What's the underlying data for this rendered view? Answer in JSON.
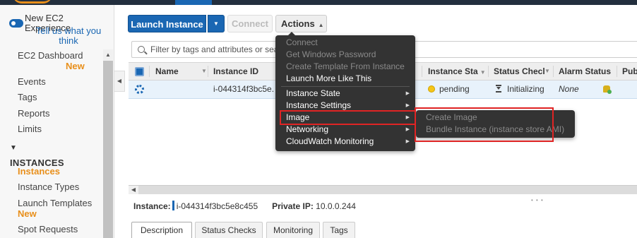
{
  "sidebar": {
    "new_experience_label": "New EC2 Experience",
    "tell_us_link": "Tell us what you think",
    "items": [
      {
        "label": "EC2 Dashboard",
        "badge": "New"
      },
      {
        "label": "Events"
      },
      {
        "label": "Tags"
      },
      {
        "label": "Reports"
      },
      {
        "label": "Limits"
      },
      {
        "label": "Instances"
      },
      {
        "label": "Instance Types"
      },
      {
        "label": "Launch Templates",
        "badge": "New"
      },
      {
        "label": "Spot Requests"
      }
    ],
    "section_instances": "INSTANCES",
    "section_arrow": "▼"
  },
  "toolbar": {
    "launch_label": "Launch Instance",
    "connect_label": "Connect",
    "actions_label": "Actions"
  },
  "filter": {
    "placeholder": "Filter by tags and attributes or sea"
  },
  "table": {
    "columns": [
      "Name",
      "Instance ID",
      "Instance Sta",
      "Status Checl",
      "Alarm Status",
      "Pub"
    ],
    "rows": [
      {
        "name": "",
        "instance_id": "i-044314f3bc5e...",
        "instance_state": "pending",
        "status_checks": "Initializing",
        "alarm_status": "None"
      }
    ]
  },
  "details": {
    "instance_label": "Instance:",
    "instance_value": "i-044314f3bc5e8c455",
    "private_ip_label": "Private IP:",
    "private_ip_value": "10.0.0.244",
    "tabs": [
      "Description",
      "Status Checks",
      "Monitoring",
      "Tags"
    ]
  },
  "actions_menu": {
    "items": [
      {
        "label": "Connect",
        "enabled": false
      },
      {
        "label": "Get Windows Password",
        "enabled": false
      },
      {
        "label": "Create Template From Instance",
        "enabled": false
      },
      {
        "label": "Launch More Like This",
        "enabled": true
      },
      {
        "label": "Instance State",
        "enabled": true,
        "submenu": true
      },
      {
        "label": "Instance Settings",
        "enabled": true,
        "submenu": true
      },
      {
        "label": "Image",
        "enabled": true,
        "submenu": true
      },
      {
        "label": "Networking",
        "enabled": true,
        "submenu": true
      },
      {
        "label": "CloudWatch Monitoring",
        "enabled": true,
        "submenu": true
      }
    ],
    "submenu_image": [
      {
        "label": "Create Image",
        "enabled": false
      },
      {
        "label": "Bundle Instance (instance store AMI)",
        "enabled": false
      }
    ]
  },
  "colors": {
    "primary_blue": "#1a67b3",
    "accent_orange": "#e88f1b",
    "menu_bg": "#333333",
    "highlight_red": "#e02424",
    "topbar": "#232f3e"
  }
}
